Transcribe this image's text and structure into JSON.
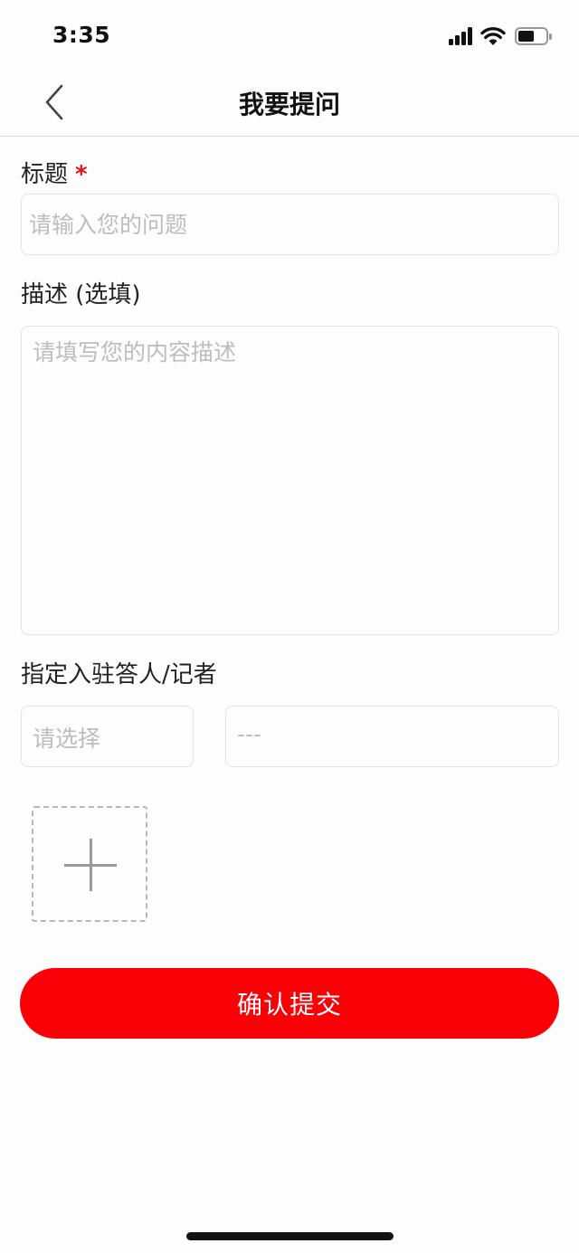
{
  "status_bar": {
    "time": "3:35",
    "icons": [
      "signal-icon",
      "wifi-icon",
      "battery-icon"
    ]
  },
  "nav": {
    "back_icon": "chevron-left-icon",
    "title": "我要提问"
  },
  "form": {
    "title_label": "标题",
    "required_mark": "*",
    "title_placeholder": "请输入您的问题",
    "description_label": "描述 (选填)",
    "description_placeholder": "请填写您的内容描述",
    "assignee_label": "指定入驻答人/记者",
    "assignee_select_placeholder": "请选择",
    "assignee_name_placeholder": "---",
    "upload_icon": "plus-icon"
  },
  "submit_label": "确认提交",
  "colors": {
    "accent": "#fa0007",
    "required": "#e8101a",
    "placeholder": "#bdbdbd",
    "border": "#e4e4e4"
  }
}
